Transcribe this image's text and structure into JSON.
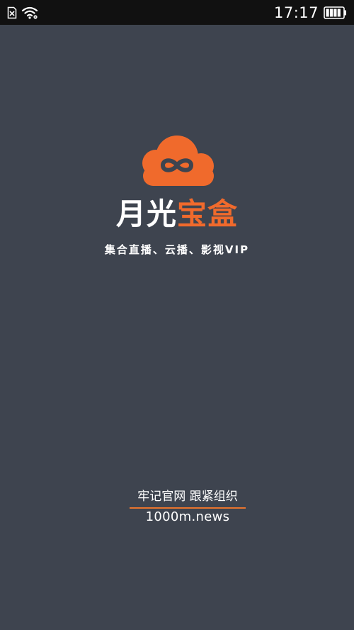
{
  "status_bar": {
    "time": "17:17",
    "icons": {
      "sim": "sim-missing-icon",
      "wifi": "wifi-icon",
      "battery": "battery-icon"
    }
  },
  "splash": {
    "logo_icon": "cloud-infinity-logo-icon",
    "title_part1": "月光",
    "title_part2": "宝盒",
    "tagline": "集合直播、云播、影视VIP"
  },
  "promo": {
    "text": "牢记官网 跟紧组织",
    "url": "1000m.news"
  },
  "colors": {
    "background": "#3e444f",
    "status_bar": "#111111",
    "accent": "#f06a2c",
    "text": "#ffffff"
  }
}
